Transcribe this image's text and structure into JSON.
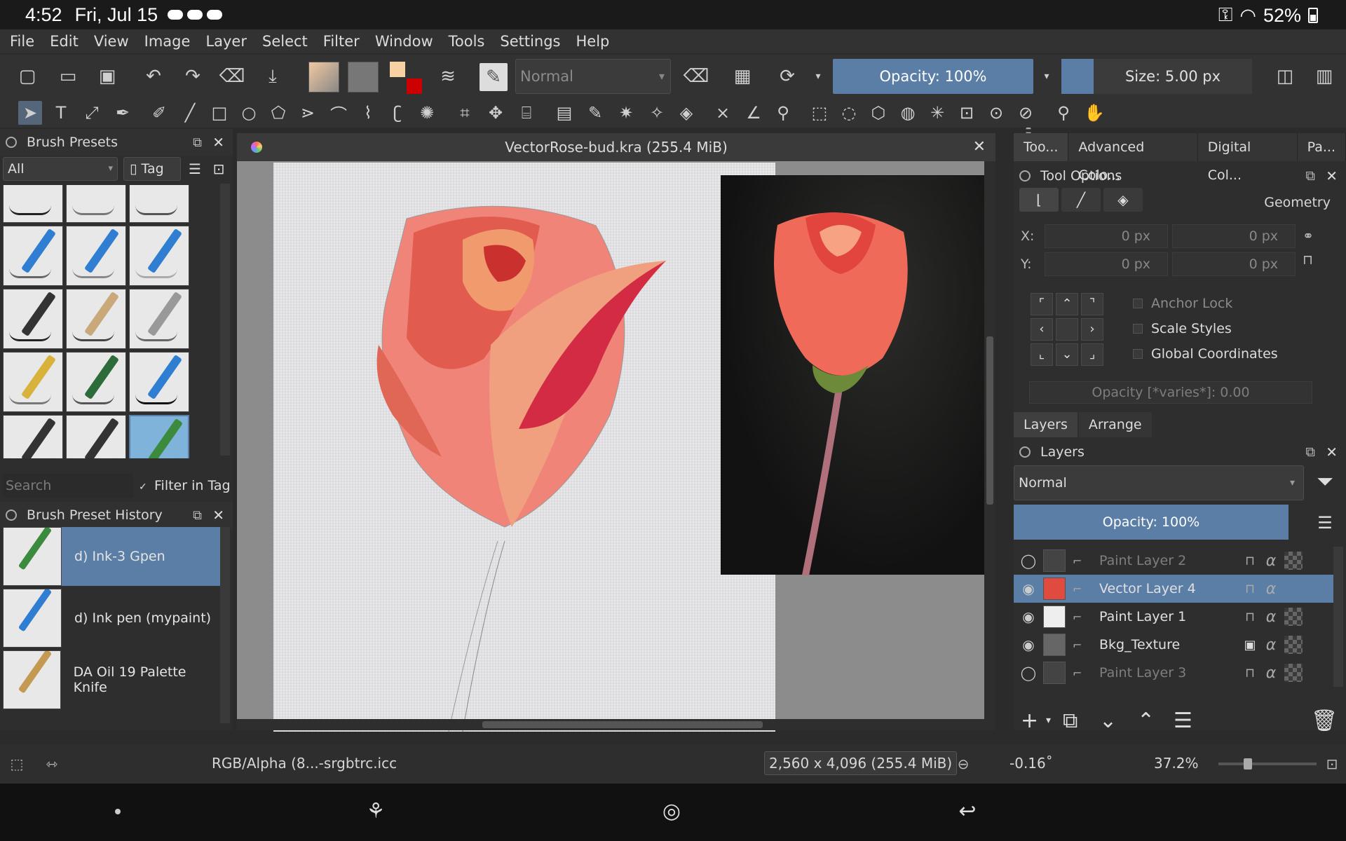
{
  "status": {
    "time": "4:52",
    "date": "Fri, Jul 15",
    "battery": "52%"
  },
  "menu": [
    "File",
    "Edit",
    "View",
    "Image",
    "Layer",
    "Select",
    "Filter",
    "Window",
    "Tools",
    "Settings",
    "Help"
  ],
  "toolbar": {
    "blend_mode": "Normal",
    "opacity": "Opacity: 100%",
    "size": "Size: 5.00 px",
    "fg_color": "#f7d0a4",
    "bg_color": "#cc0000",
    "accent": "#5a7ea6"
  },
  "brush_presets": {
    "title": "Brush Presets",
    "filter": "All",
    "tag": "Tag",
    "search_placeholder": "Search",
    "filter_in_tag": "Filter in Tag"
  },
  "brush_history": {
    "title": "Brush Preset History",
    "items": [
      {
        "name": "d) Ink-3 Gpen"
      },
      {
        "name": "d) Ink pen (mypaint)"
      },
      {
        "name": "DA Oil 19 Palette Knife"
      }
    ]
  },
  "document": {
    "title": "VectorRose-bud.kra (255.4 MiB)"
  },
  "right_tabs": [
    "Too...",
    "Advanced Colo...",
    "Digital Col...",
    "Pa..."
  ],
  "tool_options": {
    "title": "Tool Options",
    "geometry": "Geometry",
    "x_label": "X:",
    "y_label": "Y:",
    "x_value": "0 px",
    "x2_value": "0 px",
    "y_value": "0 px",
    "y2_value": "0 px",
    "anchor_lock": "Anchor Lock",
    "scale_styles": "Scale Styles",
    "global_coords": "Global Coordinates",
    "opacity": "Opacity [*varies*]: 0.00"
  },
  "layers": {
    "tabs": [
      "Layers",
      "Arrange"
    ],
    "title": "Layers",
    "blend_mode": "Normal",
    "opacity": "Opacity:  100%",
    "items": [
      {
        "name": "Paint Layer 2"
      },
      {
        "name": "Vector Layer 4"
      },
      {
        "name": "Paint Layer 1"
      },
      {
        "name": "Bkg_Texture"
      },
      {
        "name": "Paint Layer 3"
      }
    ]
  },
  "status_bottom": {
    "colorspace": "RGB/Alpha (8...-srgbtrc.icc",
    "dimensions": "2,560 x 4,096 (255.4 MiB)",
    "rotation": "-0.16˚",
    "zoom": "37.2%"
  }
}
